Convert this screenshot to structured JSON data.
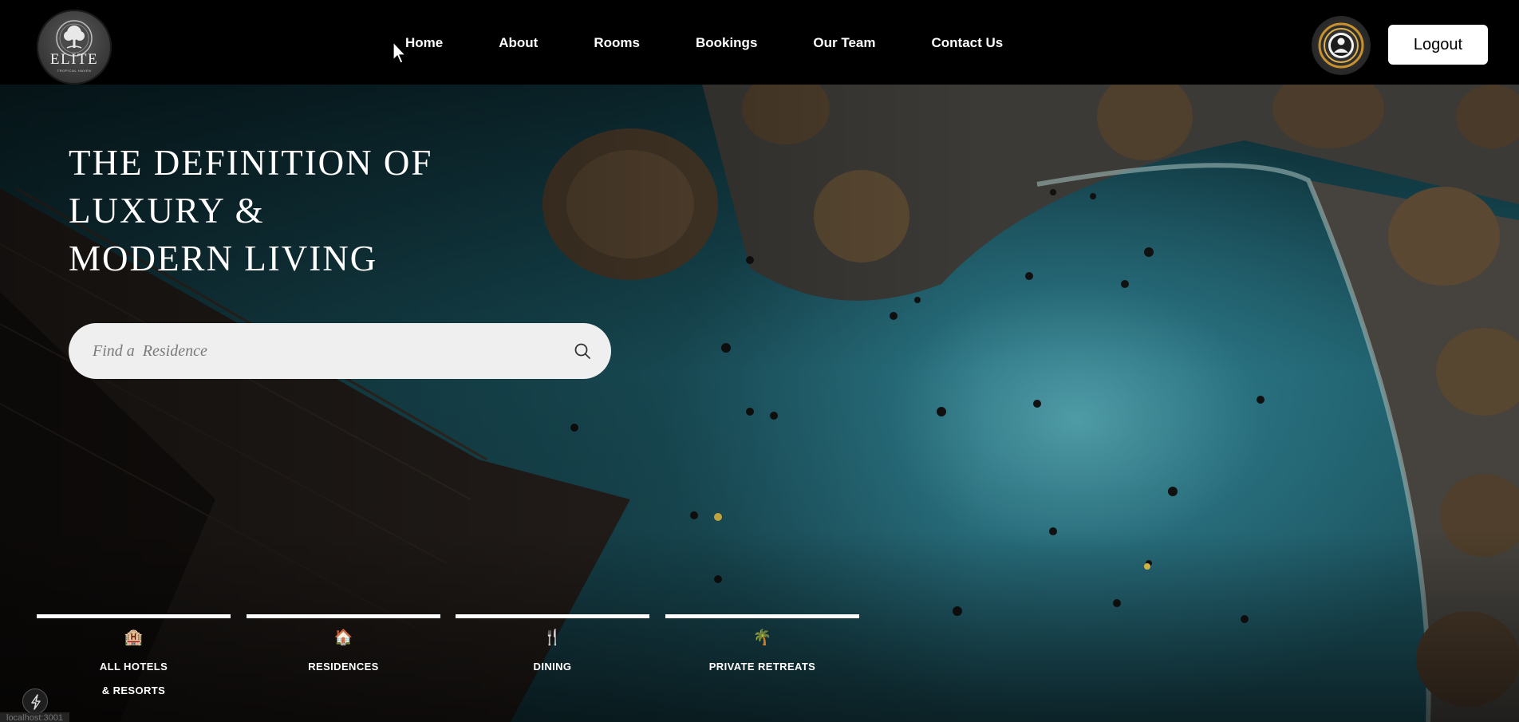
{
  "logo": {
    "word": "ELITE",
    "tagline": "TROPICAL HAVEN"
  },
  "nav": {
    "items": [
      {
        "label": "Home"
      },
      {
        "label": "About"
      },
      {
        "label": "Rooms"
      },
      {
        "label": "Bookings"
      },
      {
        "label": "Our Team"
      },
      {
        "label": "Contact Us"
      }
    ]
  },
  "account": {
    "logout_label": "Logout",
    "avatar_icon": "user-avatar-icon"
  },
  "hero": {
    "headline": [
      "THE DEFINITION OF",
      "LUXURY &",
      "MODERN LIVING"
    ],
    "search": {
      "placeholder": "Find a  Residence",
      "value": "",
      "icon": "search-icon"
    }
  },
  "categories": [
    {
      "icon": "hotel-icon",
      "glyph": "🏨",
      "label_lines": [
        "ALL HOTELS",
        "& RESORTS"
      ]
    },
    {
      "icon": "house-icon",
      "glyph": "🏠",
      "label_lines": [
        "RESIDENCES"
      ]
    },
    {
      "icon": "fork-knife-icon",
      "glyph": "🍴",
      "label_lines": [
        "DINING"
      ]
    },
    {
      "icon": "palm-tree-icon",
      "glyph": "🌴",
      "label_lines": [
        "PRIVATE RETREATS"
      ]
    }
  ],
  "dev": {
    "badge_icon": "lightning-icon",
    "host": "localhost:3001"
  },
  "colors": {
    "background": "#000000",
    "pool": "#3fa7b5",
    "button_bg": "#ffffff",
    "search_bg": "#efefef"
  }
}
